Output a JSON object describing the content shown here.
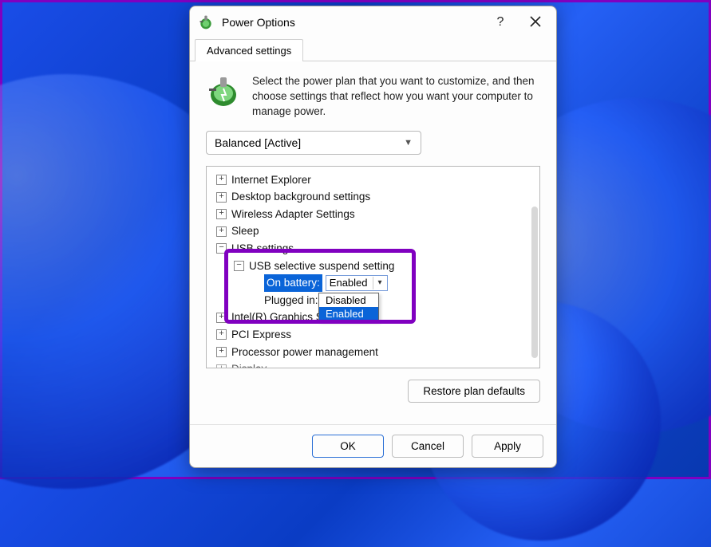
{
  "window": {
    "title": "Power Options",
    "help_tooltip": "?",
    "tab_label": "Advanced settings"
  },
  "intro": {
    "text": "Select the power plan that you want to customize, and then choose settings that reflect how you want your computer to manage power."
  },
  "plan": {
    "selected": "Balanced [Active]"
  },
  "tree": {
    "items": [
      {
        "label": "Internet Explorer",
        "expanded": false,
        "indent": 1
      },
      {
        "label": "Desktop background settings",
        "expanded": false,
        "indent": 1
      },
      {
        "label": "Wireless Adapter Settings",
        "expanded": false,
        "indent": 1
      },
      {
        "label": "Sleep",
        "expanded": false,
        "indent": 1
      },
      {
        "label": "USB settings",
        "expanded": true,
        "indent": 1
      },
      {
        "label": "USB selective suspend setting",
        "expanded": true,
        "indent": 2
      },
      {
        "label": "On battery:",
        "value": "Enabled",
        "indent": 3,
        "selected": true
      },
      {
        "label": "Plugged in:",
        "value_dropdown": true,
        "indent": 3
      },
      {
        "label": "Intel(R) Graphics Settings",
        "expanded": false,
        "indent": 1,
        "truncated": true
      },
      {
        "label": "PCI Express",
        "expanded": false,
        "indent": 1
      },
      {
        "label": "Processor power management",
        "expanded": false,
        "indent": 1
      },
      {
        "label": "Display",
        "expanded": false,
        "indent": 1,
        "cutoff": true
      }
    ],
    "dropdown_options": [
      "Disabled",
      "Enabled"
    ],
    "dropdown_selected": "Enabled"
  },
  "buttons": {
    "restore": "Restore plan defaults",
    "ok": "OK",
    "cancel": "Cancel",
    "apply": "Apply"
  }
}
